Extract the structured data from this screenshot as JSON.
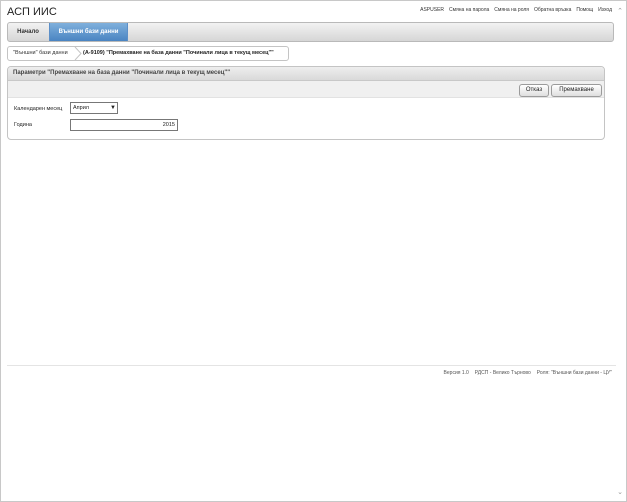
{
  "app": {
    "title": "АСП ИИС"
  },
  "top_links": [
    "ASPUSER",
    "Смяна на парола",
    "Смяна на роля",
    "Обратна връзка",
    "Помощ",
    "Изход"
  ],
  "nav": {
    "home": "Начало",
    "external_db": "Външни бази данни"
  },
  "breadcrumb": {
    "parent": "\"Външни\" бази данни",
    "current": "(А-9109) \"Премахване на база данни \"Починали лица в текущ месец\"\""
  },
  "panel": {
    "title": "Параметри \"Премахване на база данни \"Починали лица в текущ месец\"\"",
    "cancel_label": "Отказ",
    "delete_label": "Премахване",
    "month_label": "Календарен месец",
    "month_value": "Април",
    "year_label": "Година",
    "year_value": "2015"
  },
  "footer": {
    "version": "Версия 1.0",
    "office": "РДСП - Велико Търново",
    "role": "Роля: \"Външни бази данни - ЦУ\""
  },
  "colors": {
    "accent": "#4a84c2"
  },
  "icons": {
    "scroll_up": "chevron-up-icon",
    "scroll_down": "chevron-down-icon"
  }
}
